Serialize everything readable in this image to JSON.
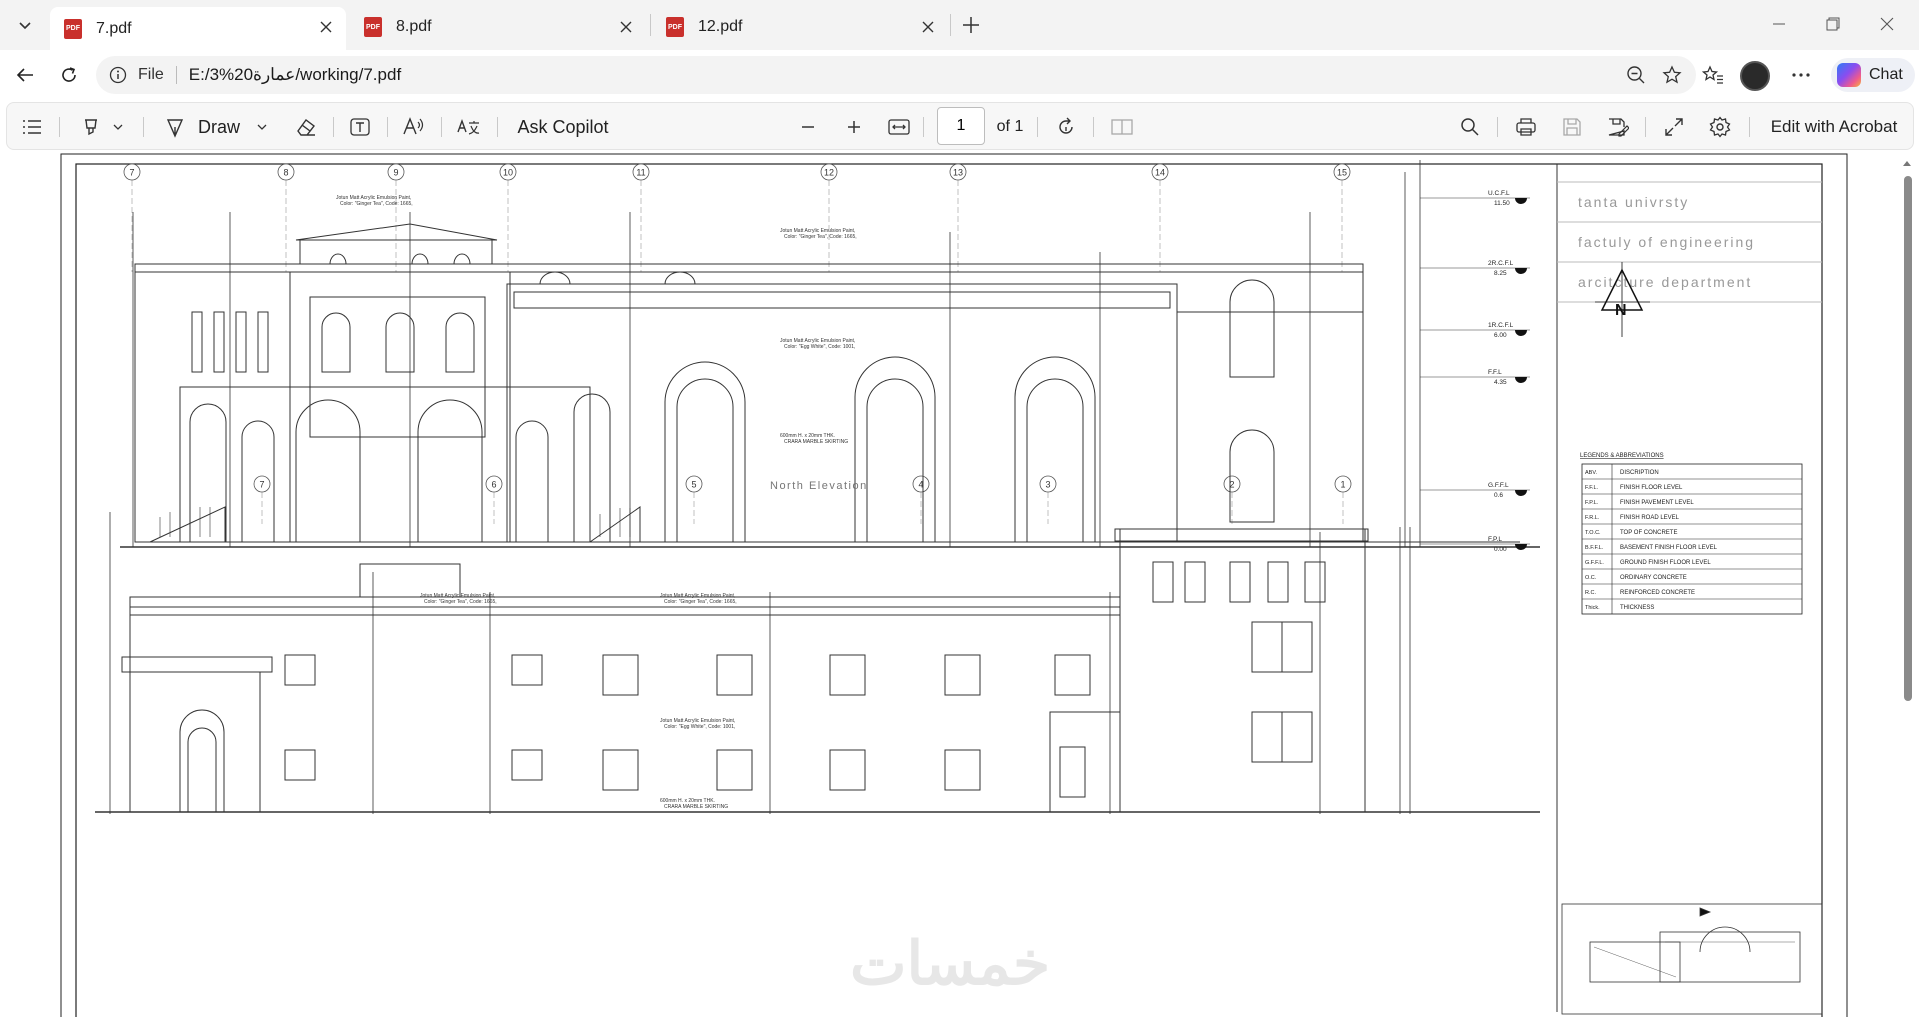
{
  "tabs": [
    {
      "title": "7.pdf",
      "active": true
    },
    {
      "title": "8.pdf",
      "active": false
    },
    {
      "title": "12.pdf",
      "active": false
    }
  ],
  "address": {
    "scheme": "File",
    "url": "E:/3%20عمارة/working/7.pdf"
  },
  "chat_label": "Chat",
  "toolbar": {
    "draw_label": "Draw",
    "ask_copilot_label": "Ask Copilot",
    "page_value": "1",
    "page_total": "of 1",
    "edit_acrobat_label": "Edit with Acrobat",
    "pdf_badge": "PDF"
  },
  "drawing": {
    "top_grid_labels": [
      "7",
      "8",
      "9",
      "10",
      "11",
      "12",
      "13",
      "14",
      "15"
    ],
    "bottom_grid_labels": [
      "7",
      "6",
      "5",
      "4",
      "3",
      "2",
      "1"
    ],
    "elevation_title": "North Elevation",
    "title_block": [
      "tanta univrsty",
      "factuly of engineering",
      "arcitcture department"
    ],
    "north_arrow_letter": "N",
    "levels_top": [
      {
        "name": "U.C.F.L",
        "value": "11.50"
      },
      {
        "name": "2R.C.F.L",
        "value": "8.25"
      },
      {
        "name": "1R.C.F.L",
        "value": "6.00"
      },
      {
        "name": "F.F.L",
        "value": "4.35"
      },
      {
        "name": "G.F.F.L",
        "value": "0.6"
      },
      {
        "name": "F.P.L",
        "value": "0.00"
      }
    ],
    "legend": {
      "title": "LEGENDS & ABBREVIATIONS",
      "header": [
        "ABV.",
        "DISCRIPTION"
      ],
      "rows": [
        [
          "F.F.L.",
          "FINISH FLOOR LEVEL"
        ],
        [
          "F.P.L.",
          "FINISH PAVEMENT LEVEL"
        ],
        [
          "F.R.L.",
          "FINISH ROAD LEVEL"
        ],
        [
          "T.O.C.",
          "TOP OF CONCRETE"
        ],
        [
          "B.F.F.L.",
          "BASEMENT FINISH FLOOR LEVEL"
        ],
        [
          "G.F.F.L.",
          "GROUND FINISH FLOOR LEVEL"
        ],
        [
          "O.C.",
          "ORDINARY CONCRETE"
        ],
        [
          "R.C.",
          "REINFORCED CONCRETE"
        ],
        [
          "Thick.",
          "THICKNESS"
        ]
      ]
    },
    "paint_note": "Jotun Matt Acrylic Emulsion Paint,",
    "paint_note_2": "Color: \"Ginger Tea\", Code: 1665,",
    "paint_note_3": "Color: \"Egg White\", Code: 1001,",
    "skirting_note": "600mm H. x 20mm THK.",
    "skirting_note_2": "CRARA MARBLE SKIRTING",
    "watermark": "خمسات"
  }
}
